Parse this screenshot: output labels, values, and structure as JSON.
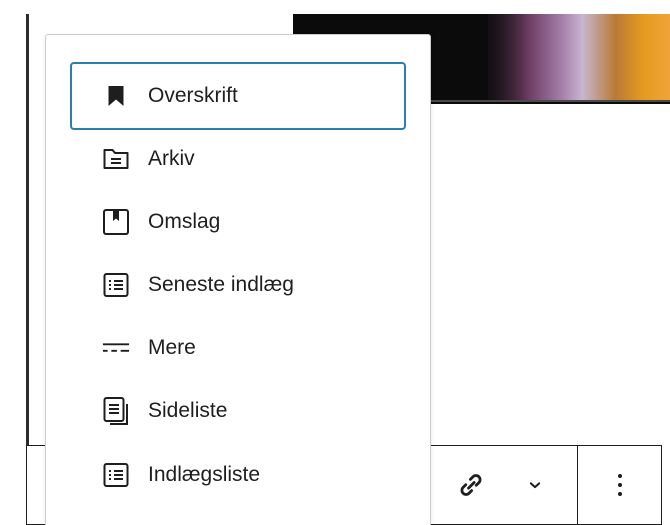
{
  "block_menu": {
    "items": [
      {
        "label": "Overskrift",
        "icon": "bookmark-icon",
        "selected": true
      },
      {
        "label": "Arkiv",
        "icon": "folder-icon",
        "selected": false
      },
      {
        "label": "Omslag",
        "icon": "cover-icon",
        "selected": false
      },
      {
        "label": "Seneste indlæg",
        "icon": "list-icon",
        "selected": false
      },
      {
        "label": "Mere",
        "icon": "more-divider-icon",
        "selected": false
      },
      {
        "label": "Sideliste",
        "icon": "pages-icon",
        "selected": false
      },
      {
        "label": "Indlægsliste",
        "icon": "list-icon",
        "selected": false
      }
    ]
  },
  "toolbar": {
    "buttons": [
      {
        "icon": "link-icon"
      },
      {
        "icon": "chevron-down-icon"
      },
      {
        "icon": "more-vertical-icon"
      }
    ]
  },
  "colors": {
    "focus_accent": "#2b7fae",
    "text": "#1e1e1e",
    "border": "#cccccc"
  }
}
